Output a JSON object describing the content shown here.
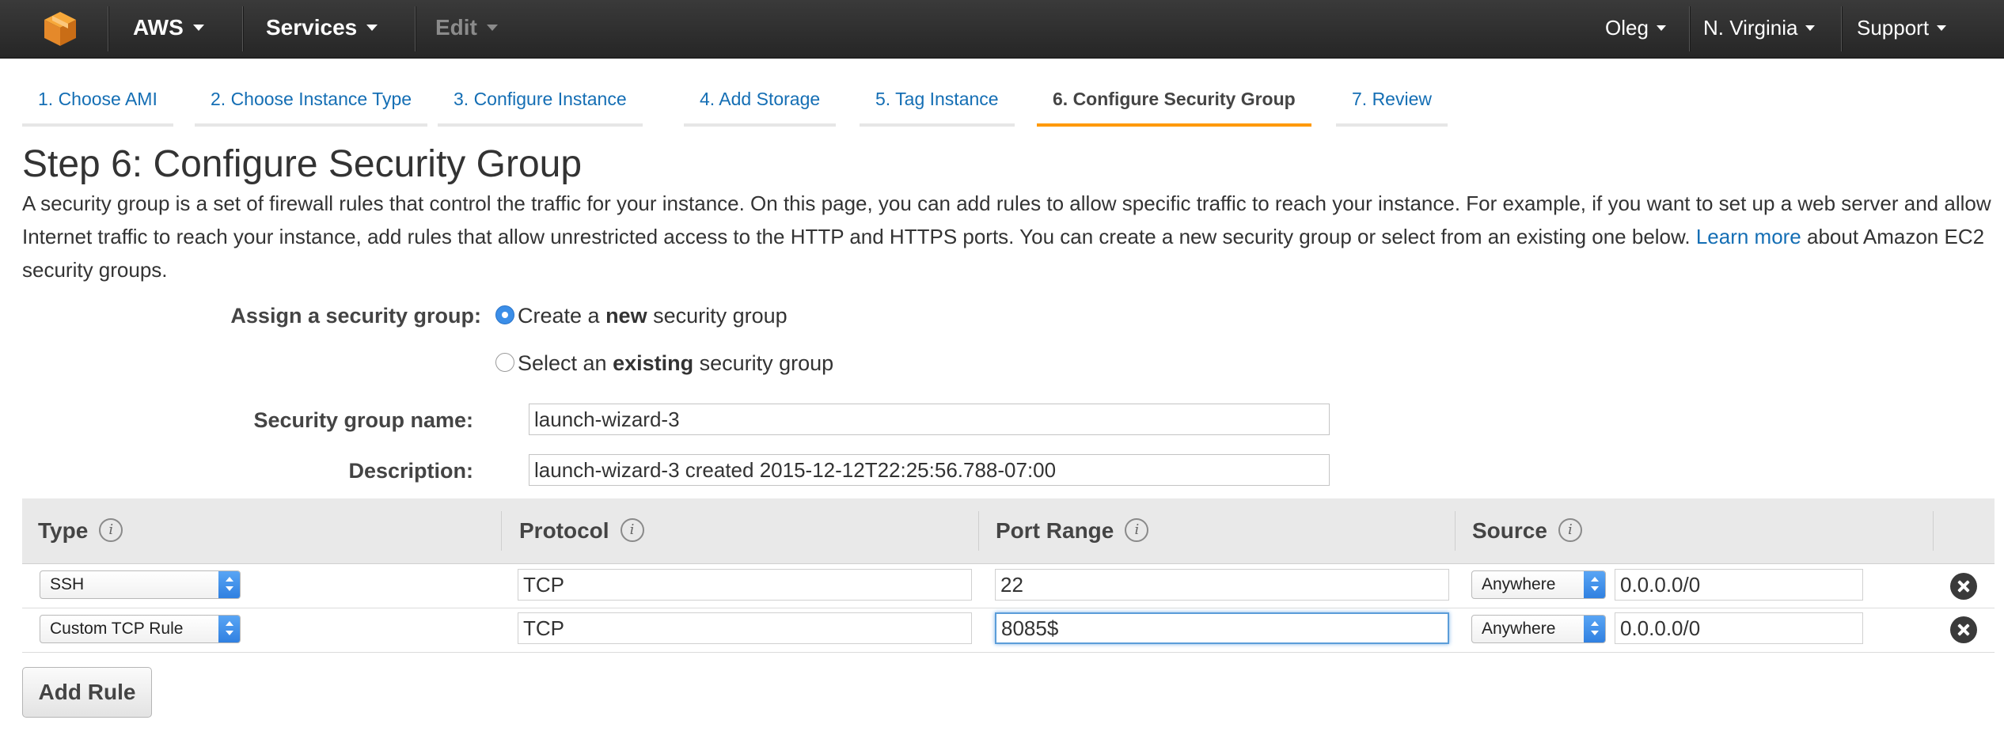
{
  "topbar": {
    "brand": "AWS",
    "services": "Services",
    "edit": "Edit",
    "user": "Oleg",
    "region": "N. Virginia",
    "support": "Support"
  },
  "wizard_tabs": [
    {
      "label": "1. Choose AMI"
    },
    {
      "label": "2. Choose Instance Type"
    },
    {
      "label": "3. Configure Instance"
    },
    {
      "label": "4. Add Storage"
    },
    {
      "label": "5. Tag Instance"
    },
    {
      "label": "6. Configure Security Group",
      "active": true
    },
    {
      "label": "7. Review"
    }
  ],
  "page": {
    "title": "Step 6: Configure Security Group",
    "intro": "A security group is a set of firewall rules that control the traffic for your instance. On this page, you can add rules to allow specific traffic to reach your instance. For example, if you want to set up a web server and allow Internet traffic to reach your instance, add rules that allow unrestricted access to the HTTP and HTTPS ports. You can create a new security group or select from an existing one below.",
    "learn_more": "Learn more",
    "intro_tail": "about Amazon EC2 security groups."
  },
  "form": {
    "assign_label": "Assign a security group:",
    "option_new": {
      "prefix": "Create a ",
      "bold": "new",
      "suffix": " security group",
      "selected": true
    },
    "option_existing": {
      "prefix": "Select an ",
      "bold": "existing",
      "suffix": " security group",
      "selected": false
    },
    "name_label": "Security group name:",
    "name_value": "launch-wizard-3",
    "description_label": "Description:",
    "description_value": "launch-wizard-3 created 2015-12-12T22:25:56.788-07:00"
  },
  "rules_table": {
    "columns": [
      "Type",
      "Protocol",
      "Port Range",
      "Source"
    ],
    "info_glyph": "i",
    "rows": [
      {
        "type": "SSH",
        "protocol": "TCP",
        "port_range": "22",
        "source": "Anywhere",
        "cidr": "0.0.0.0/0"
      },
      {
        "type": "Custom TCP Rule",
        "protocol": "TCP",
        "port_range": "8085$",
        "source": "Anywhere",
        "cidr": "0.0.0.0/0"
      }
    ],
    "add_rule_label": "Add Rule"
  },
  "colors": {
    "topbar": "#2b2b2b",
    "link": "#146eb4",
    "active_tab_underline": "#ff9900",
    "radio_selected": "#3b8ee8"
  }
}
